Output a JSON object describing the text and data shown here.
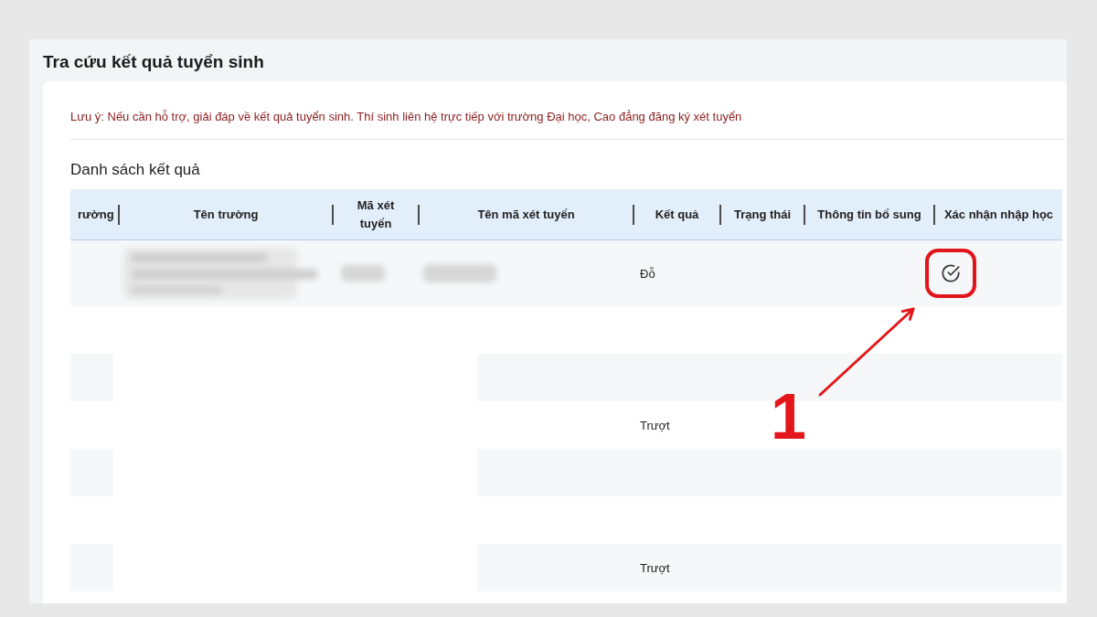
{
  "page": {
    "title": "Tra cứu kết quả tuyển sinh"
  },
  "note": "Lưu ý: Nếu cần hỗ trợ, giải đáp về kết quả tuyển sinh. Thí sinh liên hệ trực tiếp với trường Đại học, Cao đẳng đăng ký xét tuyển",
  "results": {
    "heading": "Danh sách kết quả",
    "table": {
      "columns": [
        "rường",
        "Tên trường",
        "Mã xét tuyển",
        "Tên mã xét tuyển",
        "Kết quả",
        "Trạng thái",
        "Thông tin bổ sung",
        "Xác nhận nhập học"
      ],
      "rows": [
        {
          "result": "Đỗ",
          "blurred": true,
          "blanked": false,
          "confirm_icon": true,
          "highlighted": true
        },
        {
          "blurred": false,
          "blanked": false,
          "confirm_icon": false,
          "highlighted": false
        },
        {
          "blurred": false,
          "blanked": true,
          "confirm_icon": false,
          "highlighted": false
        },
        {
          "result": "Trượt",
          "blurred": false,
          "blanked": false,
          "confirm_icon": false,
          "highlighted": false
        },
        {
          "blurred": false,
          "blanked": true,
          "confirm_icon": false,
          "highlighted": false
        },
        {
          "blurred": false,
          "blanked": false,
          "confirm_icon": false,
          "highlighted": false
        },
        {
          "result": "Trượt",
          "blurred": false,
          "blanked": true,
          "confirm_icon": false,
          "highlighted": false
        }
      ]
    }
  },
  "annotation": {
    "label": "1"
  }
}
